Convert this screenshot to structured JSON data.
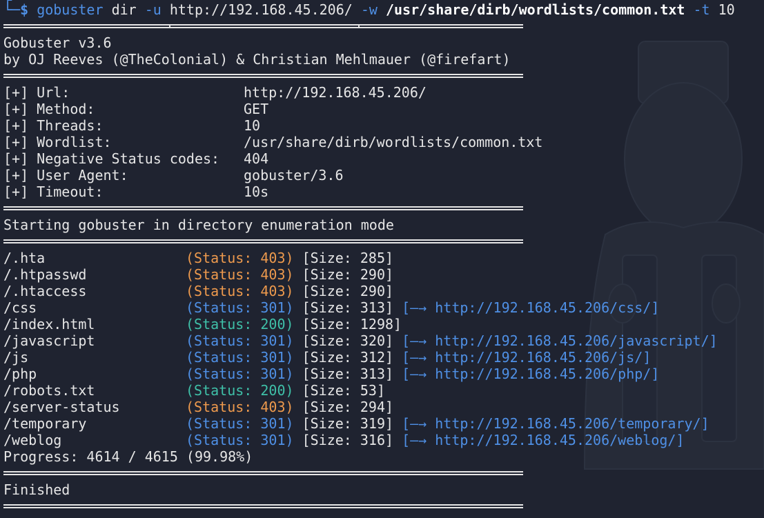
{
  "prompt": {
    "symbol": "$",
    "command": "gobuster",
    "args": [
      {
        "text": "dir",
        "kind": "cmd"
      },
      {
        "text": "-u",
        "kind": "flag"
      },
      {
        "text": "http://192.168.45.206/",
        "kind": "plain"
      },
      {
        "text": "-w",
        "kind": "flag"
      },
      {
        "text": "/usr/share/dirb/wordlists/common.txt",
        "kind": "path"
      },
      {
        "text": "-t",
        "kind": "flag"
      },
      {
        "text": "10",
        "kind": "plain"
      }
    ]
  },
  "banner": {
    "version": "Gobuster v3.6",
    "authors": "by OJ Reeves (@TheColonial) & Christian Mehlmauer (@firefart)"
  },
  "config": [
    {
      "key": "[+] Url:",
      "value": "http://192.168.45.206/"
    },
    {
      "key": "[+] Method:",
      "value": "GET"
    },
    {
      "key": "[+] Threads:",
      "value": "10"
    },
    {
      "key": "[+] Wordlist:",
      "value": "/usr/share/dirb/wordlists/common.txt"
    },
    {
      "key": "[+] Negative Status codes:",
      "value": "404"
    },
    {
      "key": "[+] User Agent:",
      "value": "gobuster/3.6"
    },
    {
      "key": "[+] Timeout:",
      "value": "10s"
    }
  ],
  "start_message": "Starting gobuster in directory enumeration mode",
  "results": [
    {
      "path": "/.hta",
      "status": "403",
      "size": "285",
      "redirect": ""
    },
    {
      "path": "/.htpasswd",
      "status": "403",
      "size": "290",
      "redirect": ""
    },
    {
      "path": "/.htaccess",
      "status": "403",
      "size": "290",
      "redirect": ""
    },
    {
      "path": "/css",
      "status": "301",
      "size": "313",
      "redirect": "http://192.168.45.206/css/"
    },
    {
      "path": "/index.html",
      "status": "200",
      "size": "1298",
      "redirect": ""
    },
    {
      "path": "/javascript",
      "status": "301",
      "size": "320",
      "redirect": "http://192.168.45.206/javascript/"
    },
    {
      "path": "/js",
      "status": "301",
      "size": "312",
      "redirect": "http://192.168.45.206/js/"
    },
    {
      "path": "/php",
      "status": "301",
      "size": "313",
      "redirect": "http://192.168.45.206/php/"
    },
    {
      "path": "/robots.txt",
      "status": "200",
      "size": "53",
      "redirect": ""
    },
    {
      "path": "/server-status",
      "status": "403",
      "size": "294",
      "redirect": ""
    },
    {
      "path": "/temporary",
      "status": "301",
      "size": "319",
      "redirect": "http://192.168.45.206/temporary/"
    },
    {
      "path": "/weblog",
      "status": "301",
      "size": "316",
      "redirect": "http://192.168.45.206/weblog/"
    }
  ],
  "progress": "Progress: 4614 / 4615 (99.98%)",
  "finished": "Finished",
  "colors": {
    "background": "#1f2330",
    "text": "#e6e6e6",
    "status_403": "#ee9a4d",
    "status_301": "#4f90e6",
    "status_200": "#3fc0a8"
  }
}
